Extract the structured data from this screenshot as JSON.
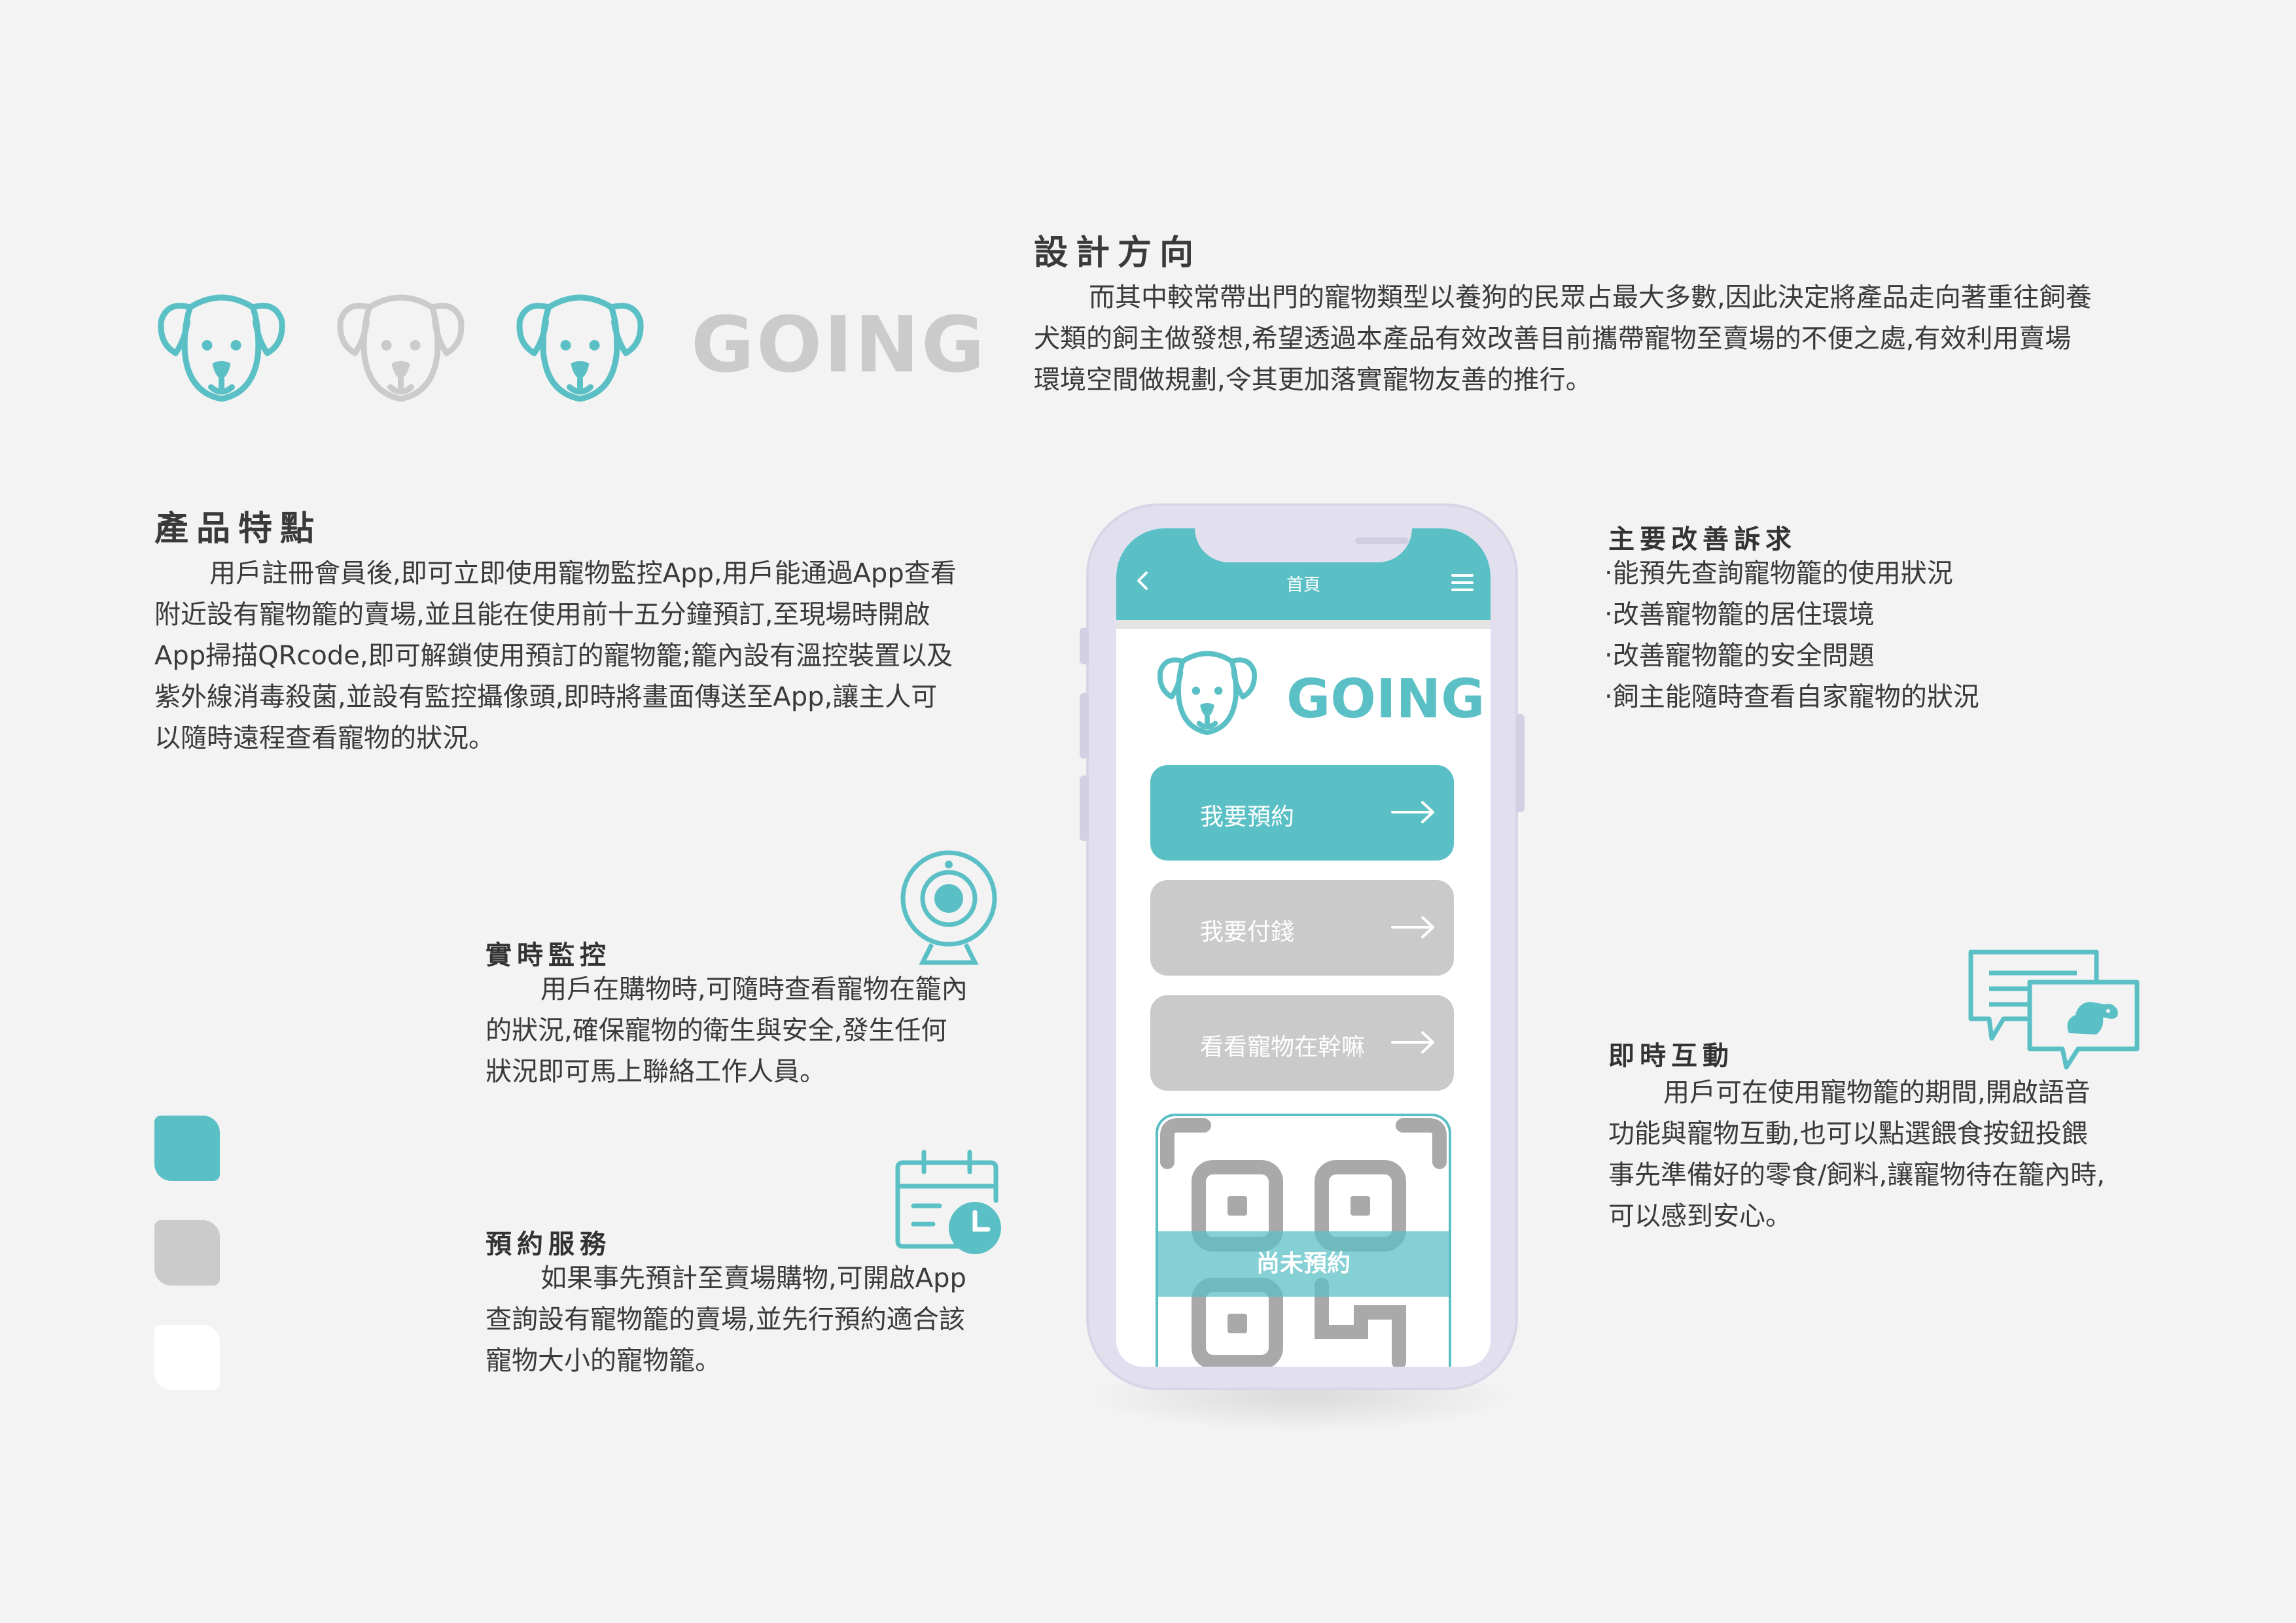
{
  "colors": {
    "accent": "#5bc0c6",
    "grey": "#cbcbcb",
    "white": "#ffffff",
    "text": "#3a3a3a"
  },
  "logo": {
    "wordmark": "GOING"
  },
  "design_direction": {
    "heading": "設計方向",
    "lines": [
      "而其中較常帶出門的寵物類型以養狗的民眾占最大多數,因此決定將產品走向著重往飼養",
      "犬類的飼主做發想,希望透過本產品有效改善目前攜帶寵物至賣場的不便之處,有效利用賣場",
      "環境空間做規劃,令其更加落實寵物友善的推行。"
    ]
  },
  "features": {
    "heading": "產品特點",
    "lines": [
      "用戶註冊會員後,即可立即使用寵物監控App,用戶能通過App查看",
      "附近設有寵物籠的賣場,並且能在使用前十五分鐘預訂,至現場時開啟",
      "App掃描QRcode,即可解鎖使用預訂的寵物籠;籠內設有溫控裝置以及",
      "紫外線消毒殺菌,並設有監控攝像頭,即時將畫面傳送至App,讓主人可",
      "以隨時遠程查看寵物的狀況。"
    ]
  },
  "realtime_monitor": {
    "heading": "實時監控",
    "icon": "webcam-icon",
    "lines": [
      "用戶在購物時,可隨時查看寵物在籠內",
      "的狀況,確保寵物的衛生與安全,發生任何",
      "狀況即可馬上聯絡工作人員。"
    ]
  },
  "reservation": {
    "heading": "預約服務",
    "icon": "calendar-clock-icon",
    "lines": [
      "如果事先預計至賣場購物,可開啟App",
      "查詢設有寵物籠的賣場,並先行預約適合該",
      "寵物大小的寵物籠。"
    ]
  },
  "main_appeals": {
    "heading": "主要改善訴求",
    "items": [
      "‧能預先查詢寵物籠的使用狀況",
      "‧改善寵物籠的居住環境",
      "‧改善寵物籠的安全問題",
      "‧飼主能隨時查看自家寵物的狀況"
    ]
  },
  "interaction": {
    "heading": "即時互動",
    "icon": "chat-dog-icon",
    "lines": [
      "用戶可在使用寵物籠的期間,開啟語音",
      "功能與寵物互動,也可以點選餵食按鈕投餵",
      "事先準備好的零食/飼料,讓寵物待在籠內時,",
      "可以感到安心。"
    ]
  },
  "app": {
    "title": "首頁",
    "wordmark": "GOING",
    "buttons": [
      "我要預約",
      "我要付錢",
      "看看寵物在幹嘛"
    ],
    "qr_status": "尚未預約"
  }
}
